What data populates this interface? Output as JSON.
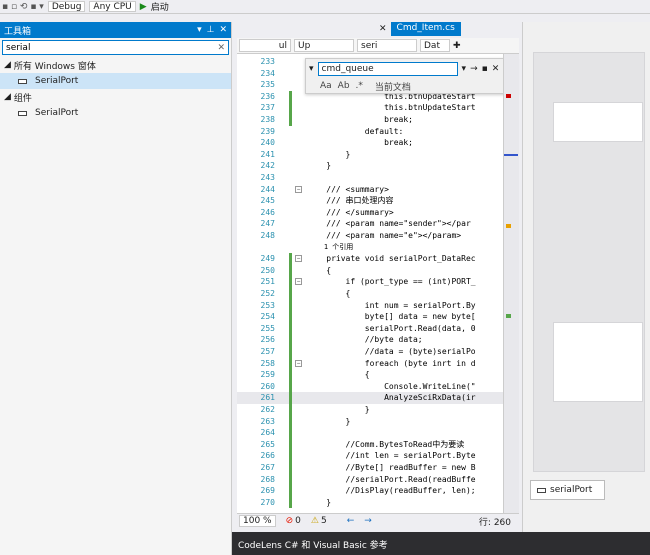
{
  "toolbar": {
    "config": "Debug",
    "platform": "Any CPU",
    "start_label": "启动"
  },
  "toolbox": {
    "title": "工具箱",
    "search_value": "serial",
    "groups": [
      {
        "label": "所有 Windows 窗体",
        "items": [
          "SerialPort"
        ]
      },
      {
        "label": "组件",
        "items": [
          "SerialPort"
        ]
      }
    ]
  },
  "editor": {
    "tabs": [
      "Cmd_Item.cs"
    ],
    "nav": [
      "ul",
      "Up",
      "t",
      "seri",
      "Dat"
    ],
    "find_text": "cmd_queue",
    "find_scope": "当前文档",
    "find_options": [
      "Aa",
      "Ab",
      ".*"
    ],
    "lines": [
      {
        "n": "233",
        "t": ""
      },
      {
        "n": "234",
        "t": ""
      },
      {
        "n": "235",
        "t": ""
      },
      {
        "n": "236",
        "t": "                this.btnUpdateStart"
      },
      {
        "n": "237",
        "t": "                this.btnUpdateStart"
      },
      {
        "n": "238",
        "t": "                break;"
      },
      {
        "n": "239",
        "t": "            default:"
      },
      {
        "n": "240",
        "t": "                break;"
      },
      {
        "n": "241",
        "t": "        }"
      },
      {
        "n": "242",
        "t": "    }"
      },
      {
        "n": "243",
        "t": ""
      },
      {
        "n": "244",
        "t": "    /// <summary>"
      },
      {
        "n": "245",
        "t": "    /// 串口处理内容"
      },
      {
        "n": "246",
        "t": "    /// </summary>"
      },
      {
        "n": "247",
        "t": "    /// <param name=\"sender\"></par"
      },
      {
        "n": "248",
        "t": "    /// <param name=\"e\"></param>"
      },
      {
        "n": "",
        "t": "    1 个引用"
      },
      {
        "n": "249",
        "t": "    private void serialPort_DataRec"
      },
      {
        "n": "250",
        "t": "    {"
      },
      {
        "n": "251",
        "t": "        if (port_type == (int)PORT_"
      },
      {
        "n": "252",
        "t": "        {"
      },
      {
        "n": "253",
        "t": "            int num = serialPort.By"
      },
      {
        "n": "254",
        "t": "            byte[] data = new byte["
      },
      {
        "n": "255",
        "t": "            serialPort.Read(data, 0"
      },
      {
        "n": "256",
        "t": "            //byte data;"
      },
      {
        "n": "257",
        "t": "            //data = (byte)serialPo"
      },
      {
        "n": "258",
        "t": "            foreach (byte inrt in d"
      },
      {
        "n": "259",
        "t": "            {"
      },
      {
        "n": "260",
        "t": "                Console.WriteLine(\""
      },
      {
        "n": "261",
        "t": "                AnalyzeSciRxData(ir"
      },
      {
        "n": "262",
        "t": "            }"
      },
      {
        "n": "263",
        "t": "        }"
      },
      {
        "n": "264",
        "t": ""
      },
      {
        "n": "265",
        "t": "        //Comm.BytesToRead中为要读"
      },
      {
        "n": "266",
        "t": "        //int len = serialPort.Byte"
      },
      {
        "n": "267",
        "t": "        //Byte[] readBuffer = new B"
      },
      {
        "n": "268",
        "t": "        //serialPort.Read(readBuffe"
      },
      {
        "n": "269",
        "t": "        //DisPlay(readBuffer, len);"
      },
      {
        "n": "270",
        "t": "    }"
      }
    ]
  },
  "status": {
    "zoom": "100 %",
    "errors": "0",
    "warnings": "5",
    "line": "行: 260"
  },
  "codelens": "CodeLens C# 和 Visual Basic 参考",
  "designer": {
    "component": "serialPort"
  }
}
